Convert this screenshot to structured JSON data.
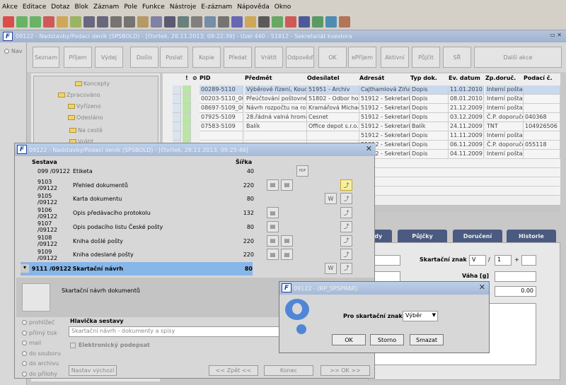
{
  "menu": [
    "Akce",
    "Editace",
    "Dotaz",
    "Blok",
    "Záznam",
    "Pole",
    "Funkce",
    "Nástroje",
    "E-záznam",
    "Nápověda",
    "Okno"
  ],
  "main_title": "09122 - Nadstavby/Podací deník (SPSBOLD) - [čtvrtek, 28.11.2013, 09:22:39] - Uzel 440 - 51812 - Sekretariát kvestora",
  "nav_label": "Nav",
  "actions": [
    "Seznam",
    "Příjem",
    "Výdej",
    "Došlo",
    "Poslat",
    "Kopie",
    "Předat",
    "Vrátit",
    "Odpověď",
    "OK",
    "ePříjem",
    "Aktivní",
    "Půjčit",
    "SŘ",
    "Další akce"
  ],
  "tree": [
    "Koncepty",
    "Zpracováno",
    "Vyřízeno",
    "Odesláno",
    "Na cestě",
    "Vrátit"
  ],
  "grid": {
    "headers": [
      "!",
      "PID",
      "Předmět",
      "Odesílatel",
      "Adresát",
      "Typ dok.",
      "Ev. datum",
      "Zp.doruč.",
      "Podací č."
    ],
    "rows": [
      [
        "",
        "00289-5110",
        "Výběrové řízení, Kouc",
        "51951 - Archiv",
        "Cajthamlová Ziňa",
        "Dopis",
        "11.01.2010",
        "Interní pošta",
        ""
      ],
      [
        "",
        "00203-5110_00",
        "Přeúčtování poštovné",
        "51802 - Odbor hos",
        "51912 - Sekretariát",
        "Dopis",
        "08.01.2010",
        "Interní pošta",
        ""
      ],
      [
        "",
        "08697-5109_00",
        "Návrh rozpočtu na rok",
        "Kramářová Michael",
        "51912 - Sekretariát",
        "Dopis",
        "21.12.2009",
        "Interní pošta",
        ""
      ],
      [
        "",
        "07925-5109",
        "28.řádná valná hromad",
        "Cesnet",
        "51912 - Sekretariát",
        "Dopis",
        "03.12.2009",
        "Č.P. doporučen",
        "040368"
      ],
      [
        "",
        "07583-5109",
        "Balík",
        "Office depot s.r.o.",
        "51912 - Sekretariát",
        "Balík",
        "24.11.2009",
        "TNT",
        "104926506"
      ],
      [
        "",
        "",
        "",
        "",
        "51912 - Sekretariát",
        "Dopis",
        "11.11.2009",
        "Interní pošta",
        ""
      ],
      [
        "",
        "",
        "",
        "",
        "51912 - Sekretariát",
        "Dopis",
        "06.11.2009",
        "Č.P. doporučen",
        "055118"
      ],
      [
        "",
        "",
        "",
        "",
        "51912 - Sekretariát",
        "Dopis",
        "04.11.2009",
        "Interní pošta",
        ""
      ]
    ]
  },
  "tabs": [
    "ady",
    "Půjčky",
    "Doručení",
    "Historie"
  ],
  "detail": {
    "skartacni_label": "Skartační znak",
    "skartacni_value": "V",
    "slash": "/",
    "num": "1",
    "plus": "+",
    "vaha_label": "Váha [g]",
    "amount": "0.00"
  },
  "report": {
    "title": "09122 - Nadstavby/Podací deník (SPSBOLD) - [čtvrtek, 28.11.2013, 09:25:46]",
    "col_sestava": "Sestava",
    "col_sirka": "Šířka",
    "rows": [
      {
        "code": "099 /09122",
        "name": "Etiketa",
        "width": "40"
      },
      {
        "code": "9103 /09122",
        "name": "Přehled dokumentů",
        "width": "220"
      },
      {
        "code": "9105 /09122",
        "name": "Karta dokumentu",
        "width": "80"
      },
      {
        "code": "9106 /09122",
        "name": "Opis předávacího protokolu",
        "width": "132"
      },
      {
        "code": "9107 /09122",
        "name": "Opis podacího listu České pošty",
        "width": "80"
      },
      {
        "code": "9108 /09122",
        "name": "Kniha došlé pošty",
        "width": "220"
      },
      {
        "code": "9109 /09122",
        "name": "Kniha odeslané pošty",
        "width": "220"
      },
      {
        "code": "9111 /09122",
        "name": "Skartační návrh",
        "width": "80"
      }
    ],
    "description": "Skartační návrh dokumentů",
    "outputs": [
      "prohlížeč",
      "přímý tisk",
      "mail",
      "do souboru",
      "do archivu",
      "do přílohy"
    ],
    "header_label": "Hlavička sestavy",
    "header_value": "Skartační návrh - dokumenty a spisy",
    "signature_label": "Elektronický podepsat",
    "defaults_btn": "Nastav výchozí",
    "back_btn": "<< Zpět <<",
    "end_btn": "Konec",
    "ok_btn": ">> OK >>"
  },
  "param": {
    "title": "09122 - (RP_SPSPRAR)",
    "label": "Pro skartační znak:",
    "value": "Výběr",
    "ok": "OK",
    "storno": "Storno",
    "smazat": "Smazat"
  }
}
